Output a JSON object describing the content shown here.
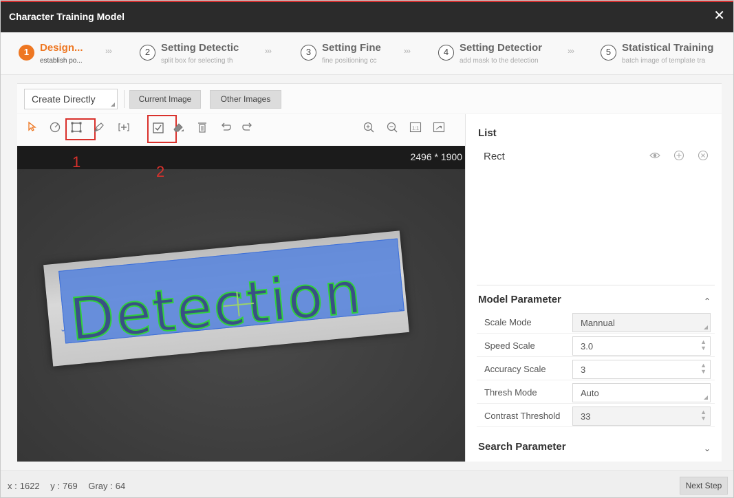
{
  "window": {
    "title": "Character Training Model",
    "close_glyph": "✕"
  },
  "steps": [
    {
      "num": "1",
      "title": "Design...",
      "subtitle": "establish po..."
    },
    {
      "num": "2",
      "title": "Setting Detectic",
      "subtitle": "split box for selecting th"
    },
    {
      "num": "3",
      "title": "Setting Fine",
      "subtitle": "fine positioning cc"
    },
    {
      "num": "4",
      "title": "Setting Detectior",
      "subtitle": "add mask to the detection"
    },
    {
      "num": "5",
      "title": "Statistical Training",
      "subtitle": "batch image of template tra"
    }
  ],
  "step_separator": "›››",
  "toolbar": {
    "create_mode": "Create Directly",
    "current_image": "Current Image",
    "other_images": "Other Images"
  },
  "annotations": {
    "one": "1",
    "two": "2"
  },
  "canvas": {
    "dimensions": "2496 * 1900",
    "sample_text": "Detection"
  },
  "list": {
    "title": "List",
    "items": [
      {
        "name": "Rect"
      }
    ]
  },
  "model_parameter": {
    "title": "Model Parameter",
    "rows": [
      {
        "label": "Scale Mode",
        "value": "Mannual"
      },
      {
        "label": "Speed Scale",
        "value": "3.0"
      },
      {
        "label": "Accuracy Scale",
        "value": "3"
      },
      {
        "label": "Thresh Mode",
        "value": "Auto"
      },
      {
        "label": "Contrast Threshold",
        "value": "33"
      }
    ]
  },
  "search_parameter": {
    "title": "Search Parameter"
  },
  "status": {
    "x_label": "x :",
    "x": "1622",
    "y_label": "y :",
    "y": "769",
    "gray_label": "Gray :",
    "gray": "64"
  },
  "next_step": "Next Step",
  "colors": {
    "accent": "#ee7722",
    "annotation_red": "#d9312c",
    "roi_blue": "#5884dc",
    "contour_green": "#2fd23a"
  }
}
